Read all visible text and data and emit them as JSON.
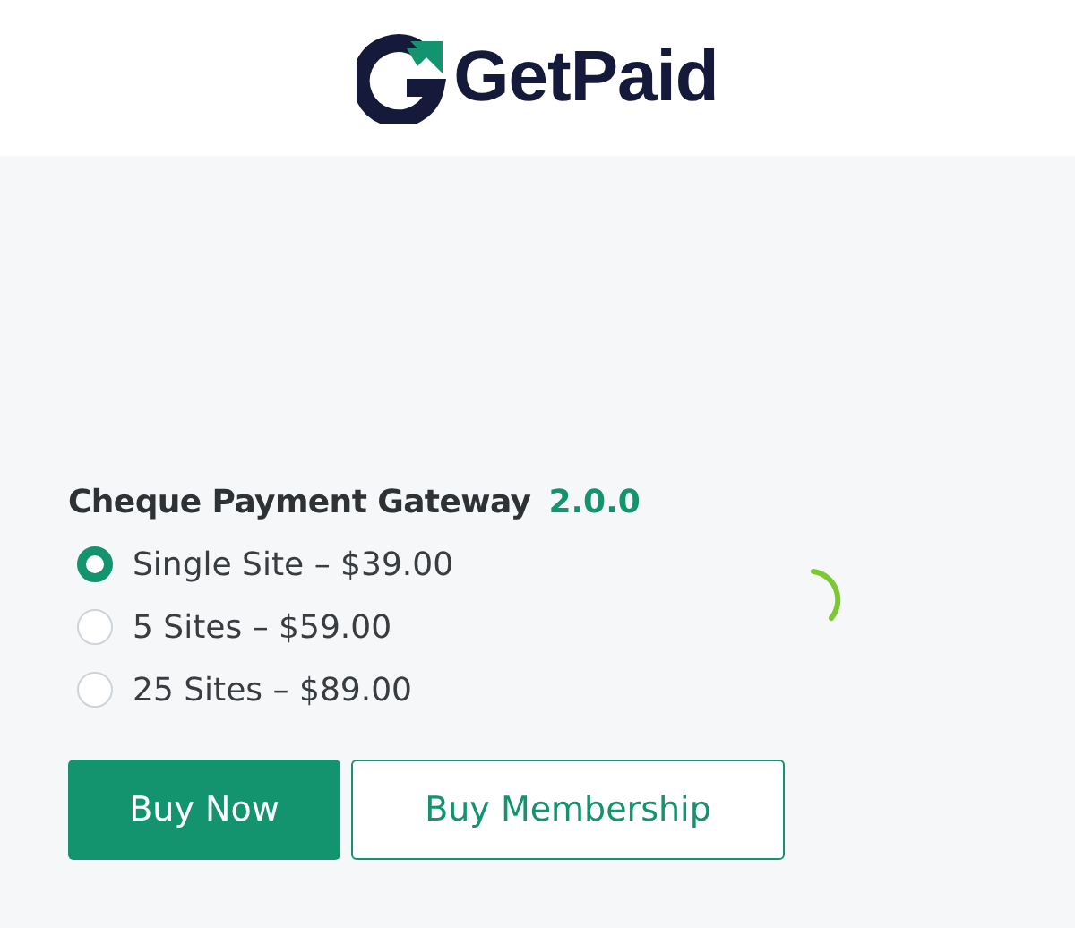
{
  "logo": {
    "text": "GetPaid"
  },
  "product": {
    "title": "Cheque Payment Gateway",
    "version": "2.0.0"
  },
  "options": [
    {
      "label": "Single Site – $39.00",
      "selected": true
    },
    {
      "label": "5 Sites – $59.00",
      "selected": false
    },
    {
      "label": "25 Sites – $89.00",
      "selected": false
    }
  ],
  "buttons": [
    {
      "label": "Buy Now",
      "kind": "primary"
    },
    {
      "label": "Buy Membership",
      "kind": "outline"
    }
  ]
}
